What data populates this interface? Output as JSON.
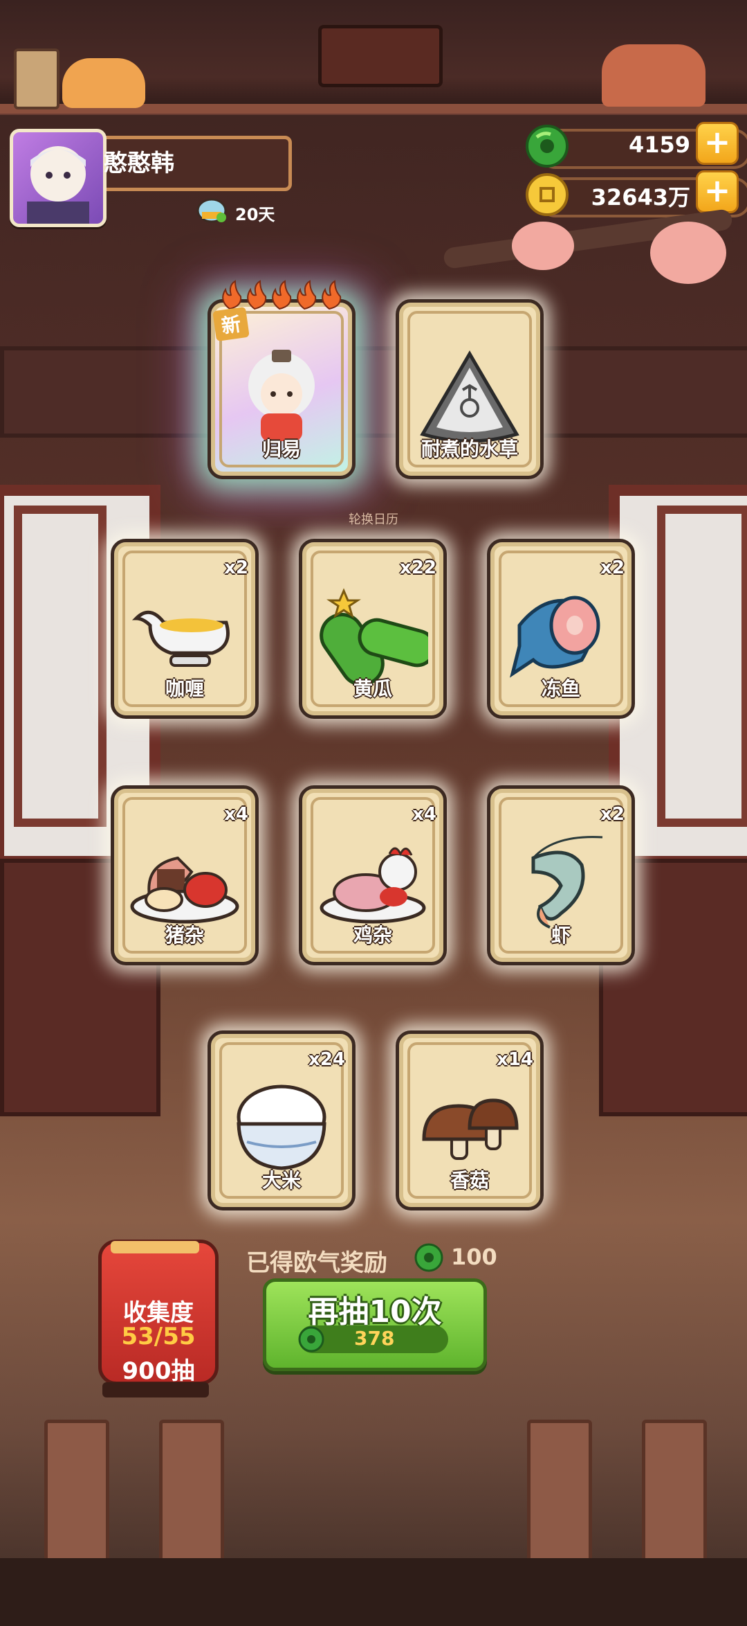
{
  "player": {
    "name": "憨憨韩",
    "days": "20天"
  },
  "currency": {
    "jade": "4159",
    "coins": "32643万"
  },
  "cards_top": [
    {
      "name": "归易",
      "badge": "新",
      "flames": 5,
      "icon": "character-icon"
    },
    {
      "name": "耐煮的水草",
      "icon": "waterweed-icon"
    }
  ],
  "rotate_note": "轮换日历",
  "cards": [
    {
      "name": "咖喱",
      "qty": "x2",
      "icon": "curry-icon"
    },
    {
      "name": "黄瓜",
      "qty": "x22",
      "icon": "cucumber-icon"
    },
    {
      "name": "冻鱼",
      "qty": "x2",
      "icon": "frozen-fish-icon"
    },
    {
      "name": "猪杂",
      "qty": "x4",
      "icon": "pork-offal-icon"
    },
    {
      "name": "鸡杂",
      "qty": "x4",
      "icon": "chicken-offal-icon"
    },
    {
      "name": "虾",
      "qty": "x2",
      "icon": "shrimp-icon"
    },
    {
      "name": "大米",
      "qty": "x24",
      "icon": "rice-icon"
    },
    {
      "name": "香菇",
      "qty": "x14",
      "icon": "mushroom-icon"
    }
  ],
  "reward": {
    "label": "已得欧气奖励",
    "value": "100"
  },
  "draw": {
    "label": "再抽10次",
    "cost": "378"
  },
  "collection": {
    "title": "收集度",
    "progress": "53/55",
    "draws": "900抽"
  },
  "colors": {
    "accent_green": "#6fc23a",
    "gold": "#f2a61b",
    "card": "#f1dfb5"
  }
}
